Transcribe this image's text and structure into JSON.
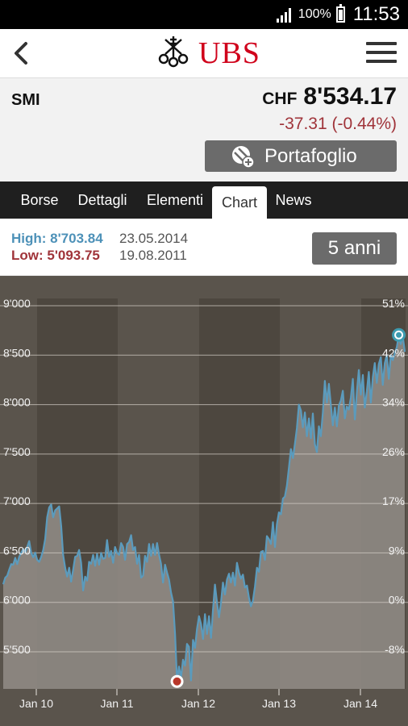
{
  "status_bar": {
    "battery": "100%",
    "time": "11:53"
  },
  "header": {
    "logo_text": "UBS",
    "back_icon": "chevron-left-icon",
    "menu_icon": "hamburger-menu-icon",
    "logo_icon": "ubs-keys-logo"
  },
  "quote": {
    "symbol": "SMI",
    "currency": "CHF",
    "price": "8'534.17",
    "change": "-37.31 (-0.44%)",
    "change_color": "#a0343a",
    "portfolio_label": "Portafoglio",
    "portfolio_icon": "portfolio-add-icon"
  },
  "tabs": [
    {
      "label": "Borse",
      "active": false
    },
    {
      "label": "Dettagli",
      "active": false
    },
    {
      "label": "Elementi",
      "active": false
    },
    {
      "label": "Chart",
      "active": true
    },
    {
      "label": "News",
      "active": false
    }
  ],
  "range_info": {
    "high_label": "High:",
    "high_value": "8'703.84",
    "high_date": "23.05.2014",
    "low_label": "Low:",
    "low_value": "5'093.75",
    "low_date": "19.08.2011",
    "period_button": "5 anni"
  },
  "chart_data": {
    "type": "area",
    "y_ticks": [
      "9'000",
      "8'500",
      "8'000",
      "7'500",
      "7'000",
      "6'500",
      "6'000",
      "5'500"
    ],
    "y_tick_values": [
      9000,
      8500,
      8000,
      7500,
      7000,
      6500,
      6000,
      5500
    ],
    "y2_ticks": [
      "51%",
      "42%",
      "34%",
      "26%",
      "17%",
      "9%",
      "0%",
      "-8%"
    ],
    "x_ticks": [
      "Jan 10",
      "Jan 11",
      "Jan 12",
      "Jan 13",
      "Jan 14"
    ],
    "ylim": [
      5000,
      9100
    ],
    "colors": {
      "line": "#5b9bbd",
      "fill": "#8f8a84",
      "bg": "#5a544c",
      "band": "#4d473f",
      "high_marker": "#3d9bb0",
      "low_marker": "#b8372a"
    },
    "high_point": {
      "date": "23.05.2014",
      "value": 8703.84
    },
    "low_point": {
      "date": "19.08.2011",
      "value": 5093.75
    },
    "series": [
      {
        "values": [
          6183,
          6250,
          6270,
          6330,
          6387,
          6380,
          6450,
          6387,
          6460,
          6500,
          6540,
          6506,
          6560,
          6620,
          6500,
          6456,
          6503,
          6430,
          6410,
          6460,
          6530,
          6640,
          6860,
          6960,
          6990,
          6860,
          6930,
          6950,
          6970,
          6770,
          6480,
          6350,
          6260,
          6350,
          6210,
          6330,
          6460,
          6470,
          6530,
          6400,
          6120,
          6260,
          6220,
          6410,
          6390,
          6480,
          6370,
          6490,
          6380,
          6500,
          6440,
          6450,
          6630,
          6460,
          6520,
          6400,
          6560,
          6500,
          6480,
          6600,
          6560,
          6430,
          6590,
          6610,
          6680,
          6530,
          6560,
          6390,
          6480,
          6250,
          6270,
          6470,
          6410,
          6590,
          6470,
          6590,
          6480,
          6600,
          6480,
          6390,
          6200,
          6380,
          6300,
          6230,
          6100,
          6010,
          5680,
          5200,
          5350,
          5240,
          5420,
          5360,
          5580,
          5550,
          5210,
          5620,
          5540,
          5730,
          5860,
          5780,
          5630,
          5880,
          5680,
          5860,
          5640,
          5920,
          6180,
          6000,
          5850,
          6000,
          6200,
          6080,
          6230,
          6290,
          6200,
          6300,
          6170,
          6400,
          6300,
          6240,
          6280,
          6150,
          6170,
          6050,
          5960,
          6020,
          6160,
          6350,
          6310,
          6510,
          6520,
          6430,
          6670,
          6640,
          6590,
          6810,
          6560,
          6790,
          6910,
          6890,
          7050,
          7070,
          7180,
          7360,
          7550,
          7460,
          7600,
          7760,
          8000,
          7940,
          7770,
          7920,
          7680,
          7860,
          7660,
          7910,
          7600,
          7520,
          7780,
          7680,
          7920,
          8240,
          8020,
          8210,
          8000,
          7790,
          7970,
          7780,
          7990,
          8040,
          8140,
          7860,
          7980,
          7950,
          8070,
          8260,
          7850,
          8120,
          8350,
          8100,
          8300,
          7970,
          8130,
          8330,
          8020,
          8280,
          8420,
          8220,
          8410,
          8480,
          8200,
          8420,
          8500,
          8260,
          8500,
          8450,
          8520,
          8580,
          8704,
          8612,
          8700,
          8534
        ]
      }
    ]
  }
}
